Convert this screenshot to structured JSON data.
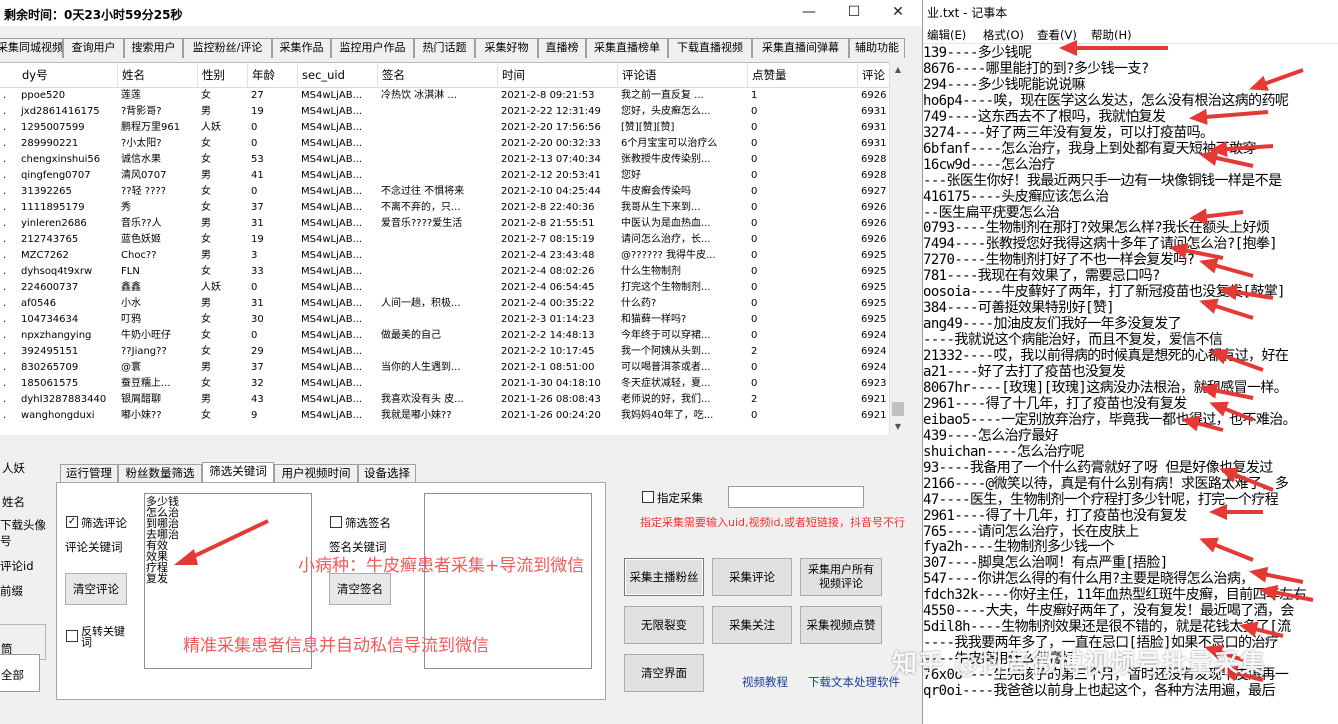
{
  "app": {
    "title": "剩余时间：0天23小时59分25秒",
    "tabs": [
      "采集同城视频",
      "查询用户",
      "搜索用户",
      "监控粉丝/评论",
      "采集作品",
      "监控用户作品",
      "热门话题",
      "采集好物",
      "直播榜",
      "采集直播榜单",
      "下载直播视频",
      "采集直播间弹幕",
      "辅助功能"
    ],
    "columns": [
      "dy号",
      "姓名",
      "性别",
      "年龄",
      "sec_uid",
      "签名",
      "时间",
      "评论语",
      "点赞量",
      "评论"
    ],
    "rows": [
      [
        "ppoe520",
        "莲莲",
        "女",
        "27",
        "MS4wLjAB...",
        "冷热饮 冰淇淋 ...",
        "2021-2-8 09:21:53",
        "我之前一直反复 ...",
        "1",
        "6926"
      ],
      [
        "jxd2861416175",
        "?背影哥?",
        "男",
        "19",
        "MS4wLjAB...",
        "",
        "2021-2-22 12:31:49",
        "您好，头皮癣怎么...",
        "0",
        "6931"
      ],
      [
        "1295007599",
        "鹏程万里961",
        "人妖",
        "0",
        "MS4wLjAB...",
        "",
        "2021-2-20 17:56:56",
        "[赞][赞][赞]",
        "0",
        "6931"
      ],
      [
        "289990221",
        "?小太阳?",
        "女",
        "0",
        "MS4wLjAB...",
        "",
        "2021-2-20 00:32:33",
        "6个月宝宝可以治疗么",
        "0",
        "6931"
      ],
      [
        "chengxinshui56",
        "诚信水果",
        "女",
        "53",
        "MS4wLjAB...",
        "",
        "2021-2-13 07:40:34",
        "张教授牛皮传染别...",
        "0",
        "6928"
      ],
      [
        "qingfeng0707",
        "清风0707",
        "男",
        "41",
        "MS4wLjAB...",
        "",
        "2021-2-12 20:53:41",
        "您好",
        "0",
        "6928"
      ],
      [
        "31392265",
        "??轻 ????",
        "女",
        "0",
        "MS4wLjAB...",
        "不念过往 不惧将来",
        "2021-2-10 04:25:44",
        "牛皮癣会传染吗",
        "0",
        "6927"
      ],
      [
        "1111895179",
        "秀",
        "女",
        "37",
        "MS4wLjAB...",
        "不离不弃的，只...",
        "2021-2-8 22:40:36",
        "我哥从生下来到...",
        "0",
        "6926"
      ],
      [
        "yinleren2686",
        "音乐??人",
        "男",
        "31",
        "MS4wLjAB...",
        "爱音乐????爱生活",
        "2021-2-8 21:55:51",
        "中医认为是血热血...",
        "0",
        "6926"
      ],
      [
        "212743765",
        "蓝色妖姬",
        "女",
        "19",
        "MS4wLjAB...",
        "",
        "2021-2-7 08:15:19",
        "请问怎么治疗，长...",
        "0",
        "6926"
      ],
      [
        "MZC7262",
        "Choc??",
        "男",
        "3",
        "MS4wLjAB...",
        "",
        "2021-2-4 23:43:48",
        "@?????? 我得牛皮...",
        "0",
        "6925"
      ],
      [
        "dyhsoq4t9xrw",
        "FLN",
        "女",
        "33",
        "MS4wLjAB...",
        "",
        "2021-2-4 08:02:26",
        "什么生物制剂",
        "0",
        "6925"
      ],
      [
        "224600737",
        "鑫鑫",
        "人妖",
        "0",
        "MS4wLjAB...",
        "",
        "2021-2-4 06:54:45",
        "打完这个生物制剂...",
        "0",
        "6925"
      ],
      [
        "af0546",
        "小水",
        "男",
        "31",
        "MS4wLjAB...",
        "人间一趟，积极...",
        "2021-2-4 00:35:22",
        "什么药?",
        "0",
        "6925"
      ],
      [
        "104734634",
        "叮鸦",
        "女",
        "30",
        "MS4wLjAB...",
        "",
        "2021-2-3 01:14:23",
        "和猫藓一样吗?",
        "0",
        "6925"
      ],
      [
        "npxzhangying",
        "牛奶小旺仔",
        "女",
        "0",
        "MS4wLjAB...",
        "做最美的自己",
        "2021-2-2 14:48:13",
        "今年终于可以穿裙...",
        "0",
        "6924"
      ],
      [
        "392495151",
        "??Jiang??",
        "女",
        "29",
        "MS4wLjAB...",
        "",
        "2021-2-2 10:17:45",
        "我一个阿姨从头到...",
        "2",
        "6924"
      ],
      [
        "830265709",
        "@寰",
        "男",
        "37",
        "MS4wLjAB...",
        "当你的人生遇到...",
        "2021-2-1 08:51:00",
        "可以喝普洱茶或者...",
        "0",
        "6924"
      ],
      [
        "185061575",
        "蚕豆糯上...",
        "女",
        "32",
        "MS4wLjAB...",
        "",
        "2021-1-30 04:18:10",
        "冬天症状减轻，夏...",
        "0",
        "6923"
      ],
      [
        "dyhI3287883440",
        "银屑醋聊",
        "男",
        "43",
        "MS4wLjAB...",
        "我喜欢没有头 皮...",
        "2021-1-26 08:08:43",
        "老师说的好，我们...",
        "2",
        "6921"
      ],
      [
        "wanghongduxi",
        "嘟小妹??",
        "女",
        "9",
        "MS4wLjAB...",
        "我就是嘟小妹??",
        "2021-1-26 00:24:20",
        "我妈妈40年了，吃...",
        "0",
        "6921"
      ]
    ],
    "left_labels": [
      "人妖",
      "姓名",
      "下载头像",
      "号",
      "评论id",
      "前缀",
      "筒",
      "全部"
    ],
    "panel_tabs": [
      "运行管理",
      "粉丝数量筛选",
      "筛选关键词",
      "用户视频时间",
      "设备选择"
    ],
    "filter": {
      "comment_check_label": "筛选评论",
      "comment_keyword_label": "评论关键词",
      "keywords": [
        "多少钱",
        "怎么治",
        "到哪治",
        "去哪治",
        "有效",
        "效果",
        "疗程",
        "复发"
      ],
      "clear_comment": "清空评论",
      "reverse_label": "反转关键词",
      "sign_check_label": "筛选签名",
      "sign_keyword_label": "签名关键词",
      "clear_sign": "清空签名"
    },
    "specify": {
      "label": "指定采集",
      "note": "指定采集需要输入uid,视频id,或者短链接，抖音号不行"
    },
    "action_buttons": [
      "采集主播粉丝",
      "采集评论",
      "采集用户所有视频评论",
      "无限裂变",
      "采集关注",
      "采集视频点赞",
      "清空界面"
    ],
    "links": [
      "视频教程",
      "下载文本处理软件"
    ],
    "overlay": {
      "headline": "小病种：牛皮癣患者采集+导流到微信",
      "subline": "精准采集患者信息并自动私信导流到微信"
    }
  },
  "notepad": {
    "title": "业.txt - 记事本",
    "menu": [
      "编辑(E)",
      "格式(O)",
      "查看(V)",
      "帮助(H)"
    ],
    "lines": [
      "139----多少钱呢",
      "8676----哪里能打的到?多少钱一支?",
      "294----多少钱呢能说说嘛",
      "ho6p4----唉，现在医学这么发达，怎么没有根治这病的药呢",
      "749----这东西去不了根吗，我就怕复发",
      "3274----好了两三年没有复发，可以打疫苗吗。",
      "6bfanf----怎么治疗，我身上到处都有夏天短袖不敢穿",
      "16cw9d----怎么治疗",
      "---张医生你好！我最近两只手一边有一块像铜钱一样是不是",
      "416175----头皮癣应该怎么治",
      "--医生扁平疣要怎么治",
      "0793----生物制剂在那打?效果怎么样?我长在额头上好烦",
      "7494----张教授您好我得这病十多年了请问怎么治?[抱拳]",
      "7270----生物制剂打好了不也一样会复发吗?",
      "781----我现在有效果了，需要忌口吗?",
      "oosoia----牛皮藓好了两年，打了新冠疫苗也没复发[鼓掌]",
      "384----可善挺效果特别好[赞]",
      "ang49----加油皮友们我好一年多没复发了",
      "----我就说这个病能治好，而且不复发，爱信不信",
      "21332----哎，我以前得病的时候真是想死的心都有过，好在",
      "a21----好了去打了疫苗也没复发",
      "8067hr----[玫瑰][玫瑰]这病没办法根治，就和感冒一样。",
      "2961----得了十几年，打了疫苗也没有复发",
      "eibao5----一定别放弃治疗，毕竟我一都也得过，也不难治。",
      "439----怎么治疗最好",
      "shuichan----怎么治疗呢",
      "93----我备用了一个什么药膏就好了呀 但是好像也复发过",
      "2166----@微笑以待，真是有什么别有病！求医路太难了，多",
      "47----医生，生物制剂一个疗程打多少针呢，打完一个疗程",
      "2961----得了十几年，打了疫苗也没有复发",
      "765----请问怎么治疗，长在皮肤上",
      "fya2h----生物制剂多少钱一个",
      "307----脚臭怎么治啊！有点严重[捂脸]",
      "547----你讲怎么得的有什么用?主要是晓得怎么治病，",
      "fdch32k----你好主任，11年血热型红斑牛皮癣，目前四年左右",
      "4550----大夫，牛皮癣好两年了，没有复发！最近喝了酒，会",
      "5dil8h----生物制剂效果还是很不错的，就是花钱太多了[流",
      "----我我要两年多了，一直在忌口[捂脸]如果不忌口的治疗",
      "----牛皮癣用什么药膏好",
      "76x0o----生完孩子的第三个月，暂时还没有发现牛皮癣再一",
      "qr0oi----我爸爸以前身上也起这个，各种方法用遍，最后"
    ]
  },
  "watermark": "知乎 @抖音微博视频号批量采集"
}
